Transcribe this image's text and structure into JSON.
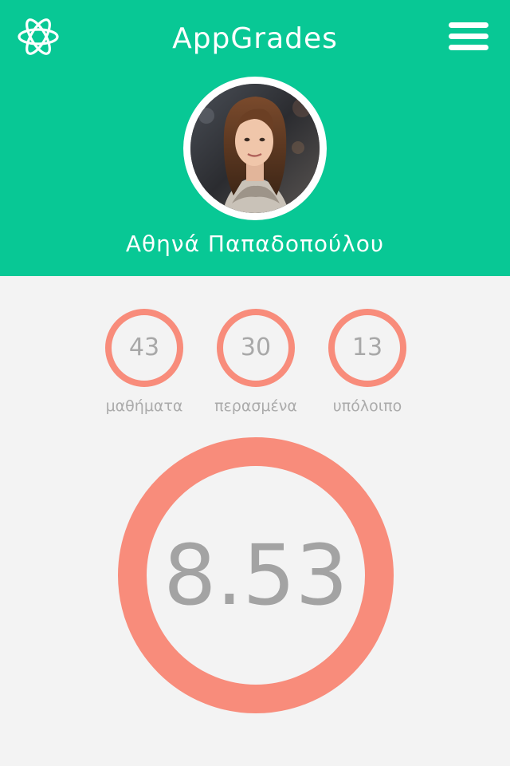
{
  "header": {
    "app_title": "AppGrades",
    "logo_icon": "atom-icon",
    "menu_icon": "hamburger-menu-icon",
    "background_color": "#08c895"
  },
  "profile": {
    "name": "Αθηνά Παπαδοπούλου",
    "avatar_icon": "user-photo"
  },
  "stats": [
    {
      "value": "43",
      "label": "μαθήματα"
    },
    {
      "value": "30",
      "label": "περασμένα"
    },
    {
      "value": "13",
      "label": "υπόλοιπο"
    }
  ],
  "average": {
    "value": "8.53"
  },
  "colors": {
    "ring": "#f88c7b",
    "text_muted": "#a8a8a8",
    "page_background": "#f3f3f3"
  }
}
